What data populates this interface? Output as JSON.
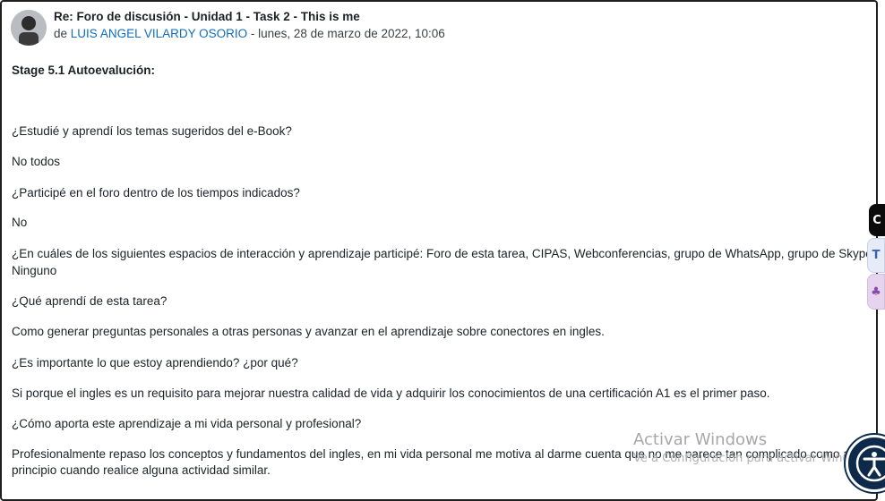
{
  "post": {
    "subject": "Re: Foro de discusión - Unidad 1 - Task 2 - This is me",
    "by_prefix": "de",
    "author": "LUIS ANGEL VILARDY OSORIO",
    "date": " - lunes, 28 de marzo de 2022, 10:06"
  },
  "content": {
    "heading": "Stage 5.1 Autoevalución:",
    "q1": "¿Estudié y aprendí los temas sugeridos del e-Book?",
    "a1": "No todos",
    "q2": "¿Participé en el foro dentro de los tiempos indicados?",
    "a2": "No",
    "q3": "¿En cuáles de los siguientes espacios de interacción y aprendizaje participé: Foro de esta tarea, CIPAS, Webconferencias, grupo de WhatsApp, grupo de Skype, etc.?",
    "a3": "Ninguno",
    "q4": "¿Qué aprendí de esta tarea?",
    "a4": "Como generar preguntas personales a otras personas y avanzar en el aprendizaje sobre conectores en ingles.",
    "q5": "¿Es importante lo que estoy aprendiendo? ¿por qué?",
    "a5": "Si porque el ingles es un requisito para mejorar nuestra calidad de vida y adquirir los conocimientos de una certificación A1 es el primer paso.",
    "q6": "¿Cómo aporta este aprendizaje a mi vida personal y profesional?",
    "a6": "Profesionalmente repaso los conceptos y fundamentos del ingles, en mi vida personal me motiva al darme cuenta que no me parece tan complicado como al principio cuando realice alguna actividad similar."
  },
  "side_tabs": {
    "tab1": "C",
    "tab2": "T",
    "tab3": "♣"
  },
  "watermark": {
    "title": "Activar Windows",
    "subtitle": "Ve a Configuración para activar Windows."
  },
  "icons": {
    "avatar": "user-avatar",
    "accessibility": "accessibility-icon"
  }
}
